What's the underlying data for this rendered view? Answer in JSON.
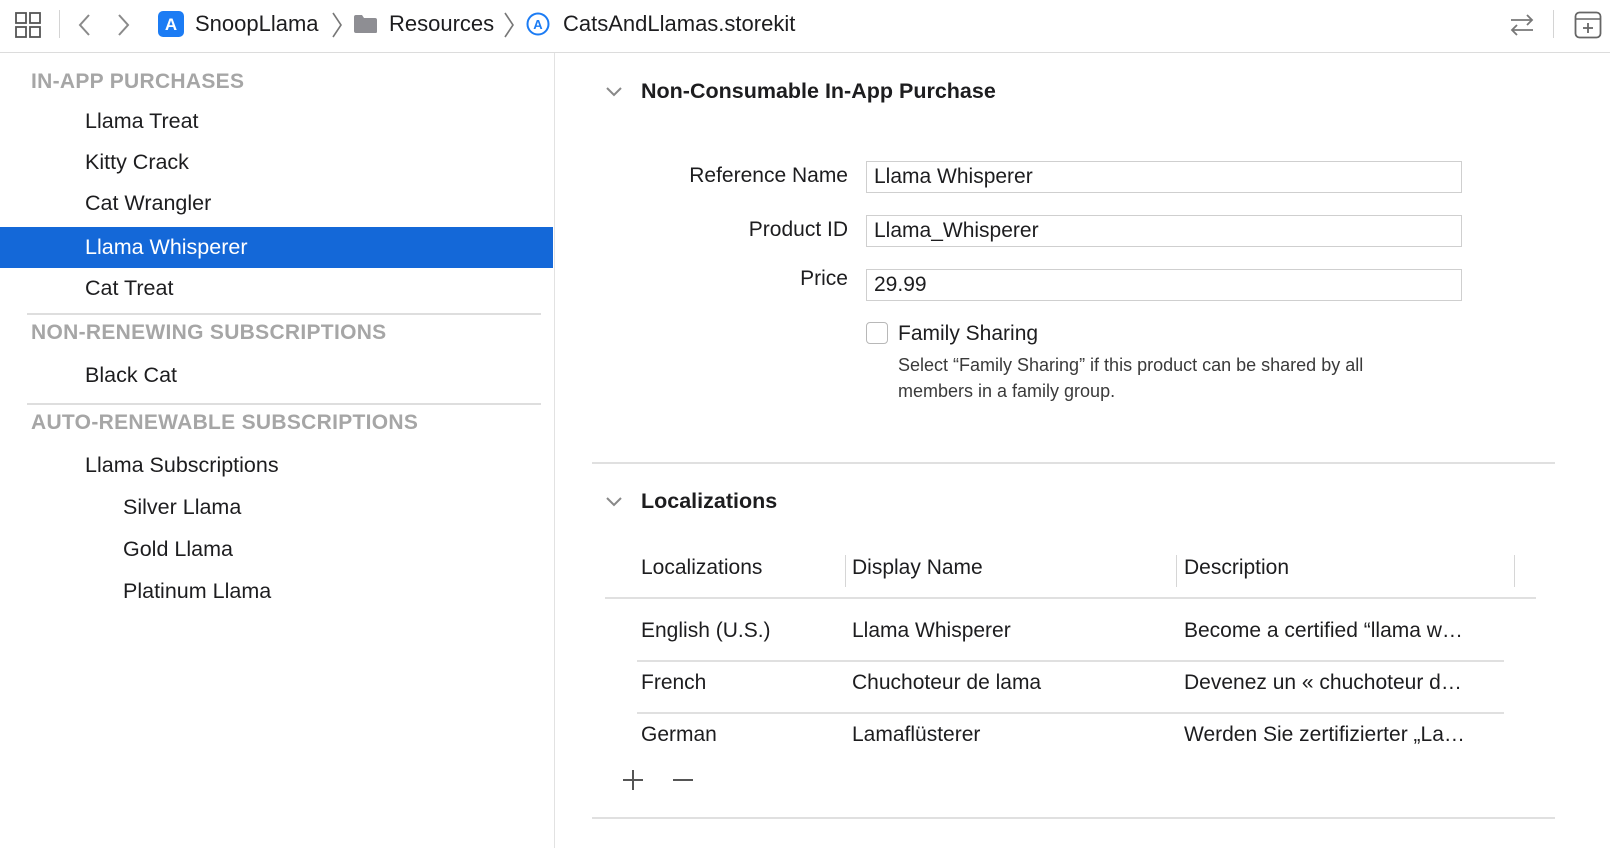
{
  "toolbar": {
    "project_name": "SnoopLlama",
    "folder_name": "Resources",
    "file_name": "CatsAndLlamas.storekit"
  },
  "sidebar": {
    "groups": [
      {
        "header": "IN-APP PURCHASES",
        "items": [
          "Llama Treat",
          "Kitty Crack",
          "Cat Wrangler",
          "Llama Whisperer",
          "Cat Treat"
        ]
      },
      {
        "header": "NON-RENEWING SUBSCRIPTIONS",
        "items": [
          "Black Cat"
        ]
      },
      {
        "header": "AUTO-RENEWABLE SUBSCRIPTIONS",
        "items": [
          "Llama Subscriptions",
          "Silver Llama",
          "Gold Llama",
          "Platinum Llama"
        ]
      }
    ],
    "selected_item": "Llama Whisperer",
    "selection_color": "#1468d8"
  },
  "product": {
    "section_title": "Non-Consumable In-App Purchase",
    "reference_name_label": "Reference Name",
    "reference_name_value": "Llama Whisperer",
    "product_id_label": "Product ID",
    "product_id_value": "Llama_Whisperer",
    "price_label": "Price",
    "price_value": "29.99",
    "family_sharing_label": "Family Sharing",
    "family_sharing_checked": false,
    "family_sharing_help_line1": "Select “Family Sharing” if this product can be shared by all",
    "family_sharing_help_line2": "members in a family group."
  },
  "localizations": {
    "section_title": "Localizations",
    "columns": [
      "Localizations",
      "Display Name",
      "Description"
    ],
    "rows": [
      {
        "locale": "English (U.S.)",
        "display_name": "Llama Whisperer",
        "description": "Become a certified “llama w…"
      },
      {
        "locale": "French",
        "display_name": "Chuchoteur de lama",
        "description": "Devenez un « chuchoteur d…"
      },
      {
        "locale": "German",
        "display_name": "Lamaflüsterer",
        "description": "Werden Sie zertifizierter „La…"
      }
    ]
  }
}
